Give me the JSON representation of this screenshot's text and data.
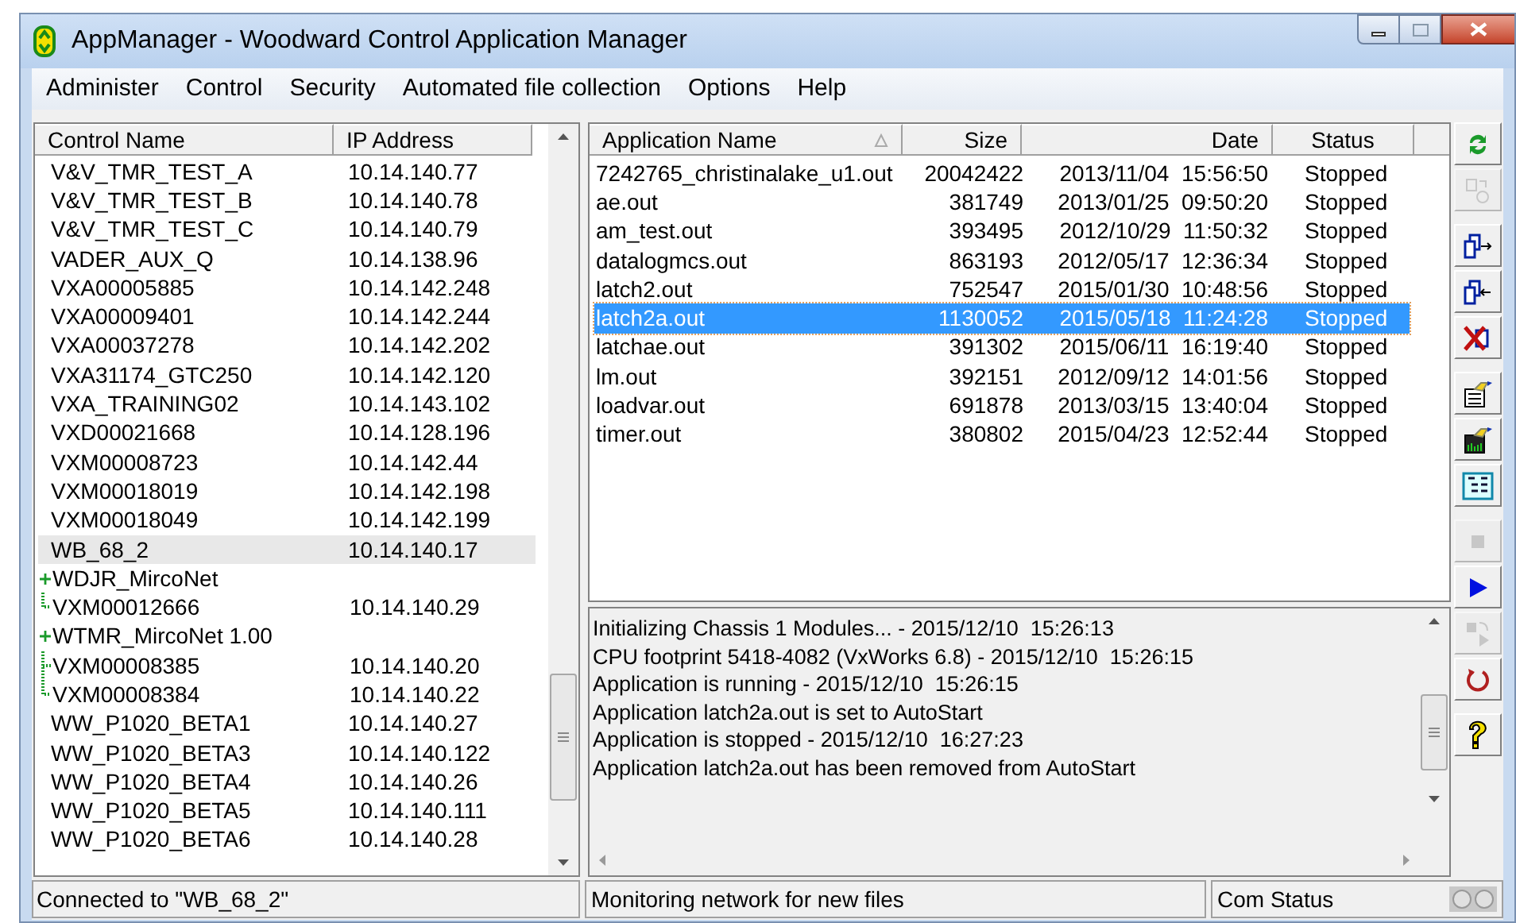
{
  "window": {
    "title": "AppManager - Woodward Control Application Manager"
  },
  "menu": [
    {
      "label": "Administer"
    },
    {
      "label": "Control"
    },
    {
      "label": "Security"
    },
    {
      "label": "Automated file collection"
    },
    {
      "label": "Options"
    },
    {
      "label": "Help"
    }
  ],
  "controls": {
    "columns": [
      "Control Name",
      "IP Address"
    ],
    "rows": [
      {
        "name": "V&V_TMR_TEST_A",
        "ip": "10.14.140.77",
        "selected": false
      },
      {
        "name": "V&V_TMR_TEST_B",
        "ip": "10.14.140.78",
        "selected": false
      },
      {
        "name": "V&V_TMR_TEST_C",
        "ip": "10.14.140.79",
        "selected": false
      },
      {
        "name": "VADER_AUX_Q",
        "ip": "10.14.138.96",
        "selected": false
      },
      {
        "name": "VXA00005885",
        "ip": "10.14.142.248",
        "selected": false
      },
      {
        "name": "VXA00009401",
        "ip": "10.14.142.244",
        "selected": false
      },
      {
        "name": "VXA00037278",
        "ip": "10.14.142.202",
        "selected": false
      },
      {
        "name": "VXA31174_GTC250",
        "ip": "10.14.142.120",
        "selected": false
      },
      {
        "name": "VXA_TRAINING02",
        "ip": "10.14.143.102",
        "selected": false
      },
      {
        "name": "VXD00021668",
        "ip": "10.14.128.196",
        "selected": false
      },
      {
        "name": "VXM00008723",
        "ip": "10.14.142.44",
        "selected": false
      },
      {
        "name": "VXM00018019",
        "ip": "10.14.142.198",
        "selected": false
      },
      {
        "name": "VXM00018049",
        "ip": "10.14.142.199",
        "selected": false
      },
      {
        "name": "WB_68_2",
        "ip": "10.14.140.17",
        "selected": true
      },
      {
        "name": "WDJR_MircoNet",
        "selected": false,
        "children": [
          {
            "name": "VXM00012666",
            "ip": "10.14.140.29",
            "selected": false
          }
        ]
      },
      {
        "name": "WTMR_MircoNet 1.00",
        "selected": false,
        "children": [
          {
            "name": "VXM00008385",
            "ip": "10.14.140.20",
            "selected": false
          },
          {
            "name": "VXM00008384",
            "ip": "10.14.140.22",
            "selected": false
          }
        ]
      },
      {
        "name": "WW_P1020_BETA1",
        "ip": "10.14.140.27",
        "selected": false
      },
      {
        "name": "WW_P1020_BETA3",
        "ip": "10.14.140.122",
        "selected": false
      },
      {
        "name": "WW_P1020_BETA4",
        "ip": "10.14.140.26",
        "selected": false
      },
      {
        "name": "WW_P1020_BETA5",
        "ip": "10.14.140.111",
        "selected": false
      },
      {
        "name": "WW_P1020_BETA6",
        "ip": "10.14.140.28",
        "selected": false
      }
    ]
  },
  "applications": {
    "columns": [
      "Application Name",
      "Size",
      "Date",
      "Status"
    ],
    "rows": [
      {
        "name": "7242765_christinalake_u1.out",
        "size": "20042422",
        "date": "2013/11/04  15:56:50",
        "status": "Stopped",
        "selected": false
      },
      {
        "name": "ae.out",
        "size": "381749",
        "date": "2013/01/25  09:50:20",
        "status": "Stopped",
        "selected": false
      },
      {
        "name": "am_test.out",
        "size": "393495",
        "date": "2012/10/29  11:50:32",
        "status": "Stopped",
        "selected": false
      },
      {
        "name": "datalogmcs.out",
        "size": "863193",
        "date": "2012/05/17  12:36:34",
        "status": "Stopped",
        "selected": false
      },
      {
        "name": "latch2.out",
        "size": "752547",
        "date": "2015/01/30  10:48:56",
        "status": "Stopped",
        "selected": false
      },
      {
        "name": "latch2a.out",
        "size": "1130052",
        "date": "2015/05/18  11:24:28",
        "status": "Stopped",
        "selected": true
      },
      {
        "name": "latchae.out",
        "size": "391302",
        "date": "2015/06/11  16:19:40",
        "status": "Stopped",
        "selected": false
      },
      {
        "name": "lm.out",
        "size": "392151",
        "date": "2012/09/12  14:01:56",
        "status": "Stopped",
        "selected": false
      },
      {
        "name": "loadvar.out",
        "size": "691878",
        "date": "2013/03/15  13:40:04",
        "status": "Stopped",
        "selected": false
      },
      {
        "name": "timer.out",
        "size": "380802",
        "date": "2015/04/23  12:52:44",
        "status": "Stopped",
        "selected": false
      }
    ]
  },
  "log": [
    "Initializing Chassis 1 Modules... - 2015/12/10  15:26:13",
    "CPU footprint 5418-4082 (VxWorks 6.8) - 2015/12/10  15:26:15",
    "Application is running - 2015/12/10  15:26:15",
    "Application latch2a.out is set to AutoStart",
    "Application is stopped - 2015/12/10  16:27:23",
    "Application latch2a.out has been removed from AutoStart"
  ],
  "toolbar": [
    [
      {
        "kind": "refresh",
        "disabled": false
      },
      {
        "kind": "convert",
        "disabled": true
      }
    ],
    [
      {
        "kind": "copy-to",
        "disabled": false
      },
      {
        "kind": "copy-from",
        "disabled": false
      },
      {
        "kind": "delete",
        "disabled": false
      }
    ],
    [
      {
        "kind": "properties",
        "disabled": false
      },
      {
        "kind": "monitor",
        "disabled": false
      },
      {
        "kind": "tree",
        "disabled": false
      }
    ],
    [
      {
        "kind": "stop",
        "disabled": true
      },
      {
        "kind": "run",
        "disabled": false
      },
      {
        "kind": "step",
        "disabled": true
      },
      {
        "kind": "restart",
        "disabled": false
      }
    ],
    [
      {
        "kind": "help",
        "disabled": false
      }
    ]
  ],
  "status_bar": {
    "connection": "Connected to \"WB_68_2\"",
    "message": "Monitoring network for new files",
    "com_label": "Com Status"
  }
}
